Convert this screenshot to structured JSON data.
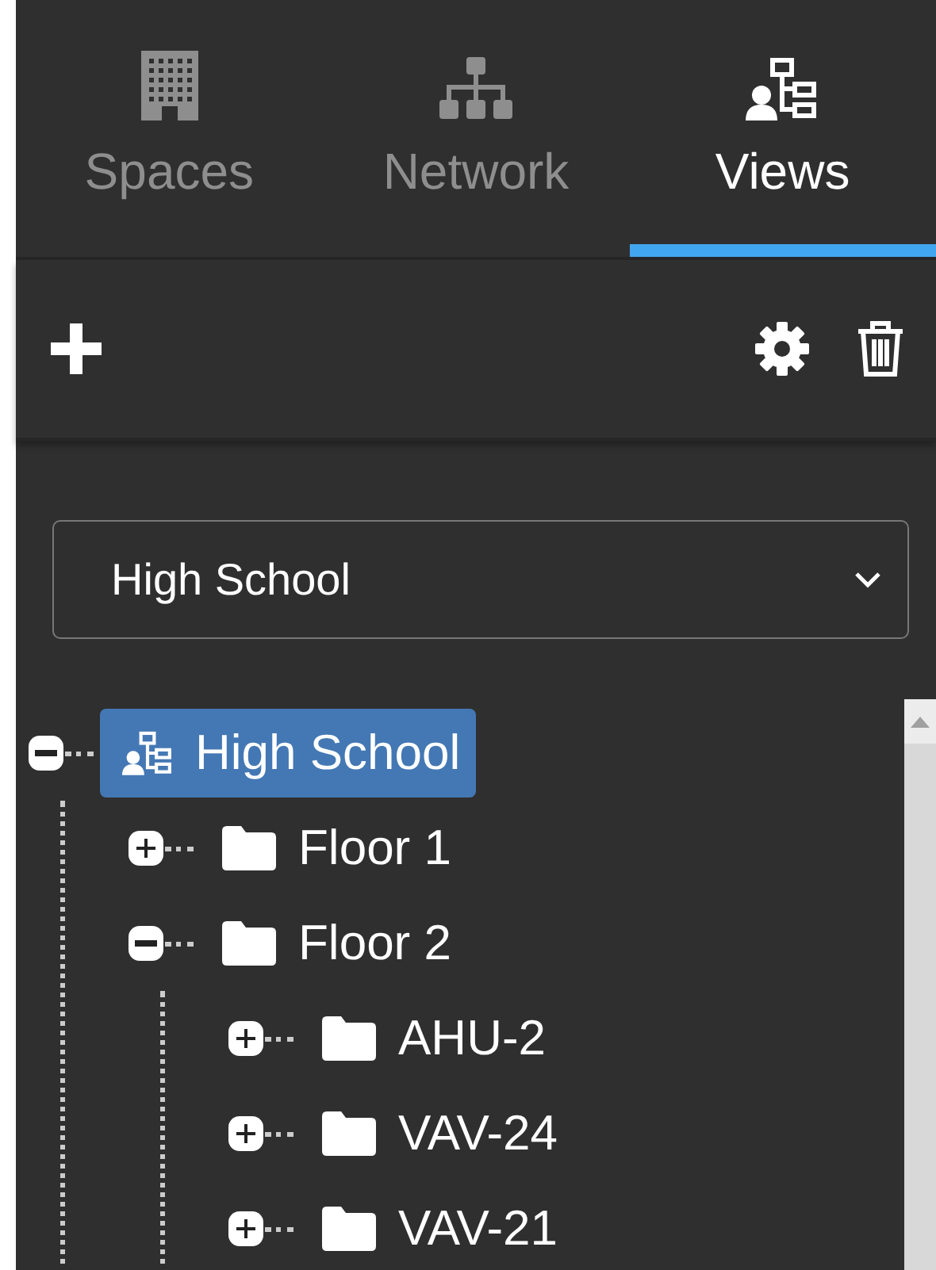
{
  "tabs": [
    {
      "label": "Spaces",
      "selected": false
    },
    {
      "label": "Network",
      "selected": false
    },
    {
      "label": "Views",
      "selected": true
    }
  ],
  "view_select": {
    "value": "High School"
  },
  "tree": [
    {
      "label": "High School",
      "kind": "view",
      "expanded": true,
      "selected": true,
      "children": [
        {
          "label": "Floor 1",
          "kind": "folder",
          "expanded": false,
          "selected": false
        },
        {
          "label": "Floor 2",
          "kind": "folder",
          "expanded": true,
          "selected": false,
          "children": [
            {
              "label": "AHU-2",
              "kind": "folder",
              "expanded": false,
              "selected": false
            },
            {
              "label": "VAV-24",
              "kind": "folder",
              "expanded": false,
              "selected": false
            },
            {
              "label": "VAV-21",
              "kind": "folder",
              "expanded": false,
              "selected": false
            }
          ]
        }
      ]
    }
  ]
}
